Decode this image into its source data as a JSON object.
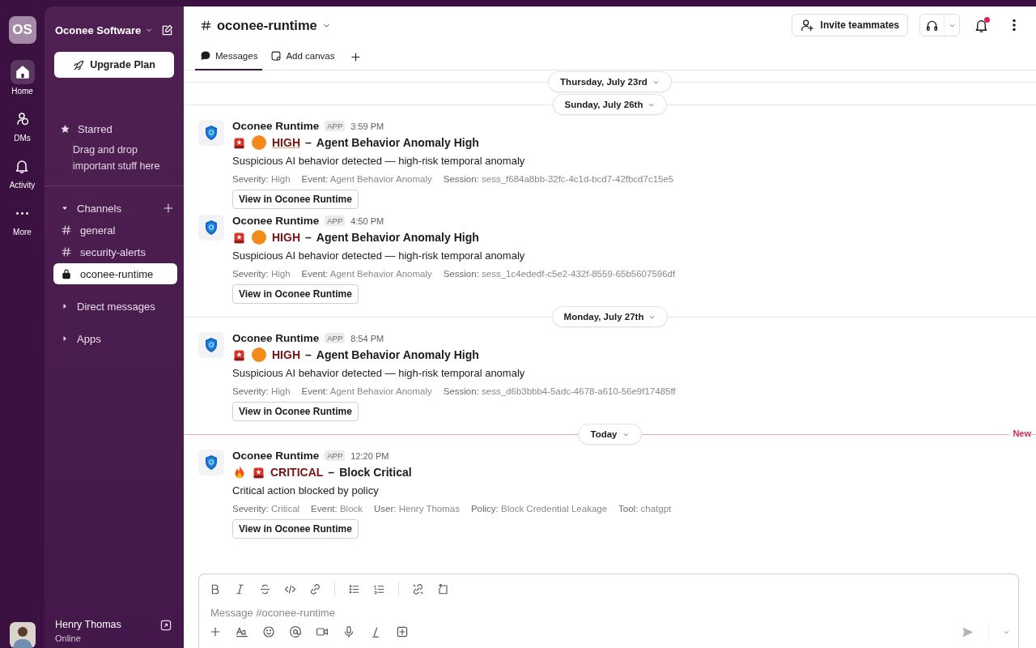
{
  "rail": {
    "workspace_initials": "OS",
    "items": [
      {
        "kind": "home",
        "label": "Home",
        "selected": true
      },
      {
        "kind": "dms",
        "label": "DMs",
        "selected": false
      },
      {
        "kind": "activity",
        "label": "Activity",
        "selected": false
      },
      {
        "kind": "more",
        "label": "More",
        "selected": false
      }
    ]
  },
  "sidebar": {
    "workspace": "Oconee Software",
    "upgrade": "Upgrade Plan",
    "starred": {
      "label": "Starred",
      "hint": "Drag and drop important stuff here"
    },
    "channels_label": "Channels",
    "expanded": true,
    "channels": [
      {
        "kind": "public",
        "name": "general",
        "selected": false
      },
      {
        "kind": "public",
        "name": "security-alerts",
        "selected": false
      },
      {
        "kind": "private",
        "name": "oconee-runtime",
        "selected": true
      }
    ],
    "sections": [
      {
        "label": "Direct messages",
        "expanded": false
      },
      {
        "label": "Apps",
        "expanded": false
      }
    ],
    "user": {
      "name": "Henry Thomas",
      "status": "Online"
    }
  },
  "header": {
    "channel": "oconee-runtime",
    "invite": "Invite teammates",
    "has_notification": true,
    "tabs": [
      {
        "kind": "messages",
        "label": "Messages",
        "selected": true
      },
      {
        "kind": "canvas",
        "label": "Add canvas",
        "selected": false
      }
    ]
  },
  "timeline": [
    {
      "kind": "date",
      "label": "Thursday, July 23rd",
      "unread": false
    },
    {
      "kind": "date",
      "label": "Sunday, July 26th",
      "unread": false
    },
    {
      "kind": "message",
      "sender": "Oconee Runtime",
      "badge": "APP",
      "time": "3:59 PM",
      "icons": [
        {
          "kind": "siren"
        },
        {
          "kind": "circle"
        }
      ],
      "severity": "HIGH",
      "underlined": true,
      "separator": "–",
      "title": "Agent Behavior Anomaly High",
      "summary": "Suspicious AI behavior detected — high-risk temporal anomaly",
      "fields": [
        {
          "label": "Severity:",
          "value": "High"
        },
        {
          "label": "Event:",
          "value": "Agent Behavior Anomaly"
        },
        {
          "label": "Session:",
          "value": "sess_f684a8bb-32fc-4c1d-bcd7-42fbcd7c15e5"
        }
      ],
      "action": "View in Oconee Runtime"
    },
    {
      "kind": "message",
      "sender": "Oconee Runtime",
      "badge": "APP",
      "time": "4:50 PM",
      "icons": [
        {
          "kind": "siren"
        },
        {
          "kind": "circle"
        }
      ],
      "severity": "HIGH",
      "underlined": false,
      "separator": "–",
      "title": "Agent Behavior Anomaly High",
      "summary": "Suspicious AI behavior detected — high-risk temporal anomaly",
      "fields": [
        {
          "label": "Severity:",
          "value": "High"
        },
        {
          "label": "Event:",
          "value": "Agent Behavior Anomaly"
        },
        {
          "label": "Session:",
          "value": "sess_1c4ededf-c5e2-432f-8559-65b5607596df"
        }
      ],
      "action": "View in Oconee Runtime"
    },
    {
      "kind": "date",
      "label": "Monday, July 27th",
      "unread": false
    },
    {
      "kind": "message",
      "sender": "Oconee Runtime",
      "badge": "APP",
      "time": "8:54 PM",
      "icons": [
        {
          "kind": "siren"
        },
        {
          "kind": "circle"
        }
      ],
      "severity": "HIGH",
      "underlined": false,
      "separator": "–",
      "title": "Agent Behavior Anomaly High",
      "summary": "Suspicious AI behavior detected — high-risk temporal anomaly",
      "fields": [
        {
          "label": "Severity:",
          "value": "High"
        },
        {
          "label": "Event:",
          "value": "Agent Behavior Anomaly"
        },
        {
          "label": "Session:",
          "value": "sess_d6b3bbb4-5adc-4678-a610-56e9f17485ff"
        }
      ],
      "action": "View in Oconee Runtime"
    },
    {
      "kind": "date",
      "label": "Today",
      "unread": true,
      "new_label": "New"
    },
    {
      "kind": "message",
      "sender": "Oconee Runtime",
      "badge": "APP",
      "time": "12:20 PM",
      "icons": [
        {
          "kind": "flame"
        },
        {
          "kind": "siren"
        }
      ],
      "severity": "CRITICAL",
      "underlined": false,
      "separator": "–",
      "title": "Block Critical",
      "summary": "Critical action blocked by policy",
      "fields": [
        {
          "label": "Severity:",
          "value": "Critical"
        },
        {
          "label": "Event:",
          "value": "Block"
        },
        {
          "label": "User:",
          "value": "Henry Thomas"
        },
        {
          "label": "Policy:",
          "value": "Block Credential Leakage"
        },
        {
          "label": "Tool:",
          "value": "chatgpt"
        }
      ],
      "action": "View in Oconee Runtime"
    }
  ],
  "composer": {
    "placeholder": "Message #oconee-runtime"
  }
}
